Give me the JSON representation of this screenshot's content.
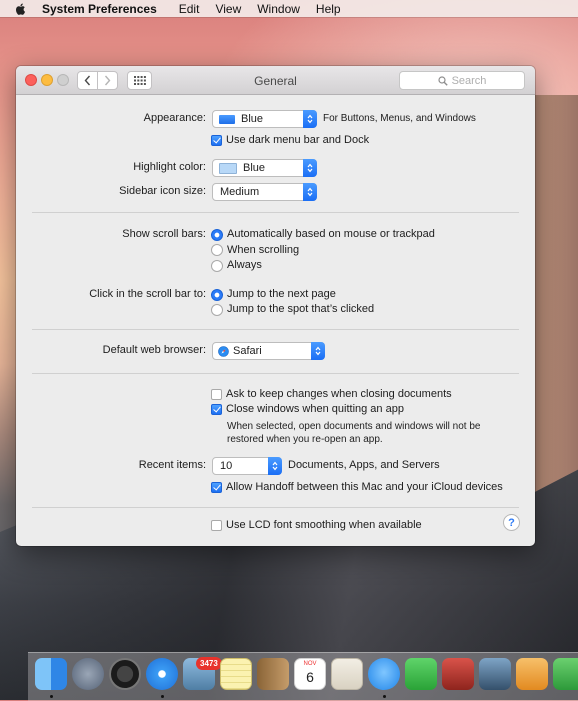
{
  "menubar": {
    "app_name": "System Preferences",
    "items": [
      "Edit",
      "View",
      "Window",
      "Help"
    ]
  },
  "window": {
    "title": "General",
    "search_placeholder": "Search"
  },
  "appearance": {
    "label": "Appearance:",
    "value": "Blue",
    "note": "For Buttons, Menus, and Windows",
    "dark_menu_label": "Use dark menu bar and Dock",
    "dark_menu_checked": true
  },
  "highlight": {
    "label": "Highlight color:",
    "value": "Blue"
  },
  "sidebar_size": {
    "label": "Sidebar icon size:",
    "value": "Medium"
  },
  "scroll_bars": {
    "label": "Show scroll bars:",
    "options": [
      "Automatically based on mouse or trackpad",
      "When scrolling",
      "Always"
    ],
    "selected_index": 0
  },
  "click_scroll": {
    "label": "Click in the scroll bar to:",
    "options": [
      "Jump to the next page",
      "Jump to the spot that’s clicked"
    ],
    "selected_index": 0
  },
  "browser": {
    "label": "Default web browser:",
    "value": "Safari"
  },
  "windows": {
    "ask_keep_label": "Ask to keep changes when closing documents",
    "ask_keep_checked": false,
    "close_windows_label": "Close windows when quitting an app",
    "close_windows_checked": true,
    "close_note_line1": "When selected, open documents and windows will not be",
    "close_note_line2": "restored when you re-open an app."
  },
  "recent": {
    "label": "Recent items:",
    "value": "10",
    "suffix": "Documents, Apps, and Servers"
  },
  "handoff": {
    "label": "Allow Handoff between this Mac and your iCloud devices",
    "checked": true
  },
  "lcd": {
    "label": "Use LCD font smoothing when available",
    "checked": false
  },
  "help_label": "?",
  "dock": {
    "photos_badge": "3473",
    "calendar_month": "NOV",
    "calendar_day": "6",
    "colors": {
      "finder": "#3a9bf0",
      "launchpad": "#6d7a8d",
      "dashboard": "#2b2b2b",
      "safari": "#2a8cf2",
      "photo_browser": "#6aa0c6",
      "notes": "#f7e37a",
      "contacts": "#b58a5a",
      "calendar": "#ffffff",
      "preview": "#e9e4d8",
      "messages": "#3fa7f7",
      "facetime": "#3ec24a",
      "photo_booth": "#c0392b",
      "iphoto": "#4a6c8c",
      "pages": "#f2a53b",
      "numbers": "#3aa648"
    }
  }
}
